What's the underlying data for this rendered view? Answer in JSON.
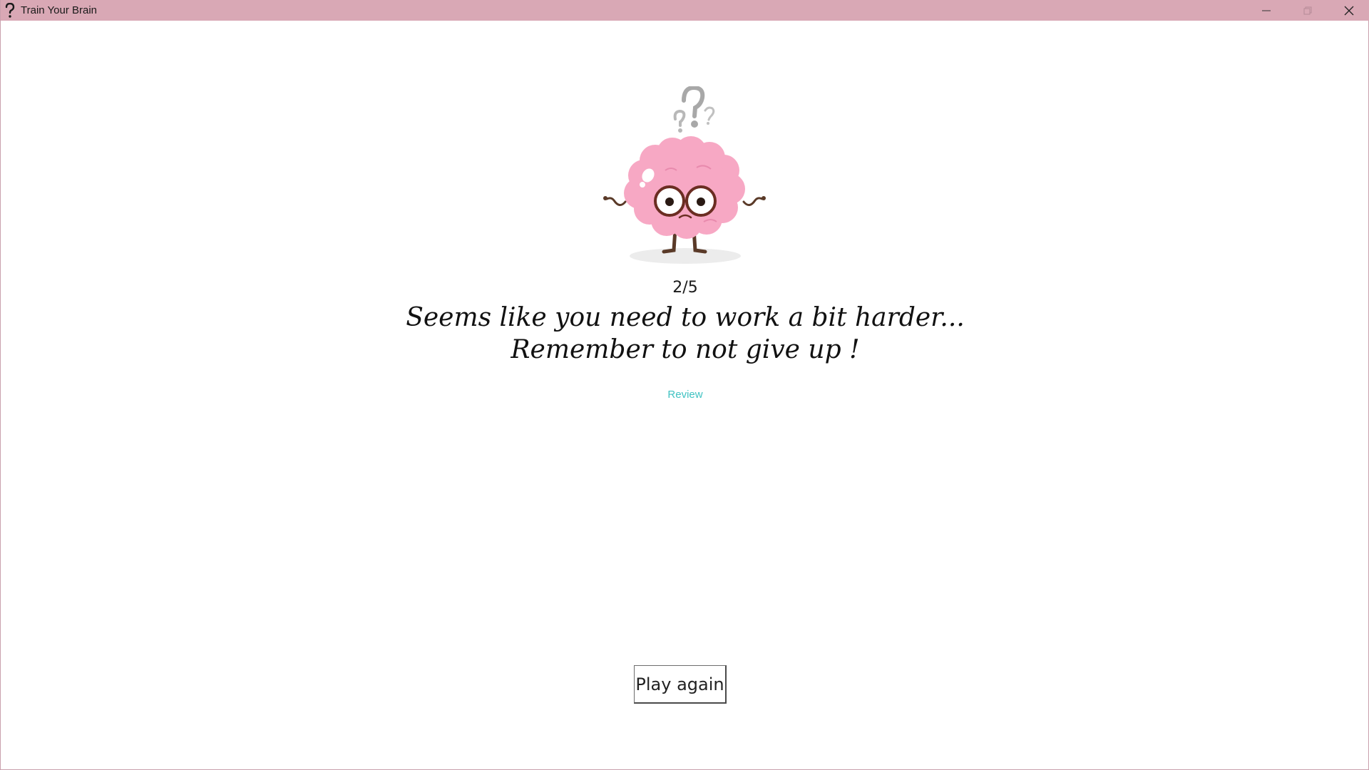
{
  "window": {
    "title": "Train Your Brain",
    "icon": "question-mark-icon",
    "controls": [
      "minimize-icon",
      "maximize-icon",
      "close-icon"
    ]
  },
  "result": {
    "score": "2/5",
    "message_line1": "Seems like you need to work a bit harder...",
    "message_line2": "Remember to not give up !",
    "review_label": "Review",
    "play_again_label": "Play again"
  },
  "colors": {
    "titlebar": "#d9a8b5",
    "brain": "#f7a8c4",
    "link": "#3fc2c2"
  }
}
